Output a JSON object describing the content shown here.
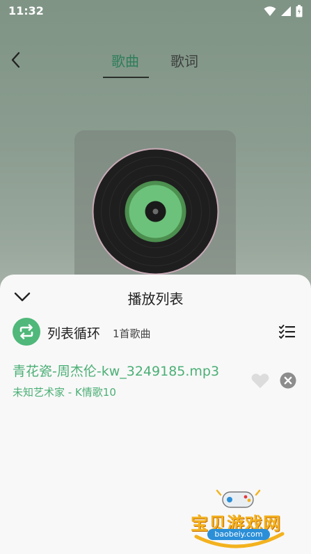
{
  "status_bar": {
    "time": "11:32"
  },
  "header": {
    "tabs": [
      {
        "label": "歌曲",
        "active": true
      },
      {
        "label": "歌词",
        "active": false
      }
    ]
  },
  "playlist_sheet": {
    "title": "播放列表",
    "mode_label": "列表循环",
    "count": "1首歌曲",
    "tracks": [
      {
        "title": "青花瓷-周杰伦-kw_3249185.mp3",
        "subtitle": "未知艺术家 - K情歌10"
      }
    ]
  },
  "watermark": {
    "text": "宝贝游戏网",
    "url": "baobeiy.com"
  },
  "colors": {
    "accent": "#4caf76",
    "sheet_bg": "#f8f8f8"
  },
  "icons": [
    "back-arrow-icon",
    "wifi-icon",
    "signal-icon",
    "battery-icon",
    "chevron-down-icon",
    "repeat-icon",
    "playlist-manage-icon",
    "heart-icon",
    "close-icon"
  ]
}
